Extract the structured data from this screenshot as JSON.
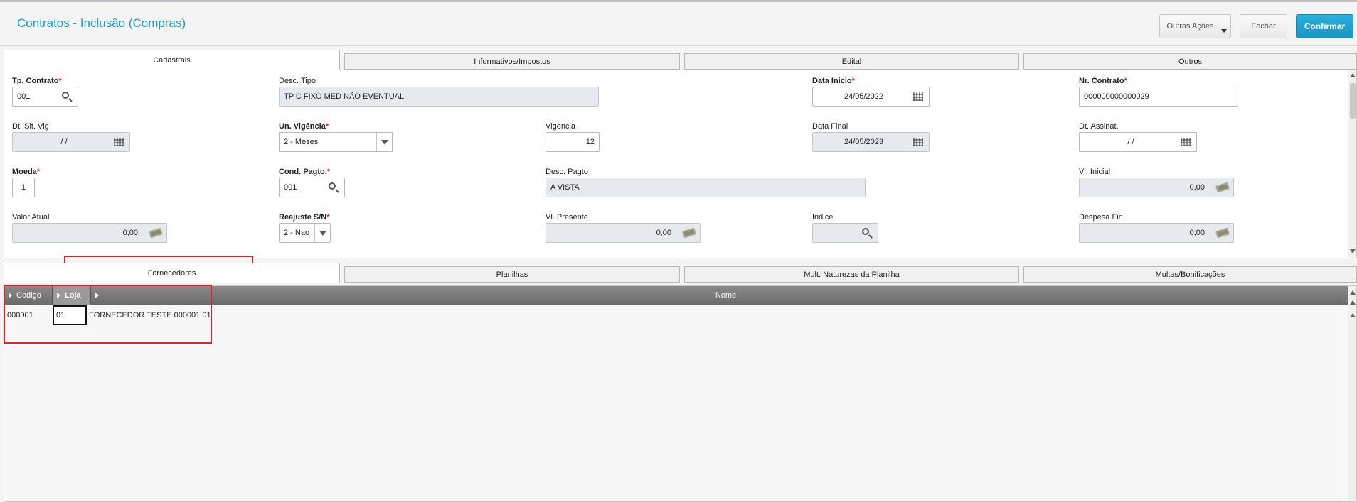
{
  "header": {
    "title": "Contratos - Inclusão (Compras)",
    "buttons": {
      "outras": "Outras Ações",
      "fechar": "Fechar",
      "confirmar": "Confirmar"
    }
  },
  "top_tabs": [
    "Cadastrais",
    "Informativos/Impostos",
    "Edital",
    "Outros"
  ],
  "form": {
    "tp_contrato": {
      "label": "Tp. Contrato",
      "value": "001"
    },
    "desc_tipo": {
      "label": "Desc. Tipo",
      "value": "TP C FIXO MED NÃO EVENTUAL"
    },
    "data_inicio": {
      "label": "Data Inicio",
      "value": "24/05/2022"
    },
    "nr_contrato": {
      "label": "Nr. Contrato",
      "value": "000000000000029"
    },
    "dt_sit_vig": {
      "label": "Dt. Sit. Vig",
      "value": "/  /"
    },
    "un_vigencia": {
      "label": "Un. Vigência",
      "value": "2 - Meses"
    },
    "vigencia": {
      "label": "Vigencia",
      "value": "12"
    },
    "data_final": {
      "label": "Data Final",
      "value": "24/05/2023"
    },
    "dt_assinat": {
      "label": "Dt. Assinat.",
      "value": "/  /"
    },
    "moeda": {
      "label": "Moeda",
      "value": "1"
    },
    "cond_pagto": {
      "label": "Cond. Pagto.",
      "value": "001"
    },
    "desc_pagto": {
      "label": "Desc. Pagto",
      "value": "A VISTA"
    },
    "vl_inicial": {
      "label": "Vl. Inicial",
      "value": "0,00"
    },
    "valor_atual": {
      "label": "Valor Atual",
      "value": "0,00"
    },
    "reajuste": {
      "label": "Reajuste S/N",
      "value": "2 - Nao"
    },
    "vl_presente": {
      "label": "Vl. Presente",
      "value": "0,00"
    },
    "indice": {
      "label": "Indice",
      "value": ""
    },
    "despesa_fin": {
      "label": "Despesa Fin",
      "value": "0,00"
    },
    "required_mark": "*"
  },
  "bottom_tabs": [
    "Fornecedores",
    "Planilhas",
    "Mult. Naturezas da Planilha",
    "Multas/Bonificações"
  ],
  "grid": {
    "columns": [
      "Codigo",
      "Loja",
      "Nome"
    ],
    "rows": [
      {
        "codigo": "000001",
        "loja": "01",
        "nome": "FORNECEDOR TESTE 000001 01"
      }
    ]
  },
  "icons": [
    "search-icon",
    "calendar-icon",
    "money-icon",
    "chevron-down-icon",
    "sort-arrow-icon"
  ],
  "colors": {
    "title": "#1a9cd0",
    "confirm": "#1a94c4",
    "required": "#e0201c",
    "highlight": "#e52222",
    "grid_header": "#6b6b6b"
  }
}
